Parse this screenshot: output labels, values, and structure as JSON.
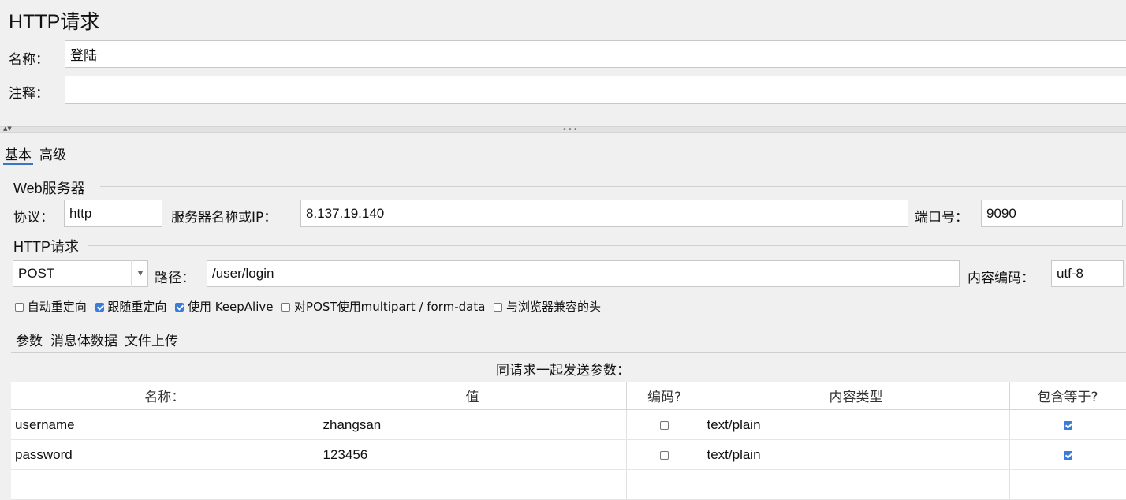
{
  "window": {
    "title": "HTTP请求"
  },
  "name_field": {
    "label": "名称：",
    "value": "登陆"
  },
  "comment_field": {
    "label": "注释：",
    "value": ""
  },
  "top_tabs": [
    {
      "label": "基本",
      "active": true
    },
    {
      "label": "高级",
      "active": false
    }
  ],
  "web_server": {
    "section_label": "Web服务器",
    "protocol_label": "协议：",
    "protocol_value": "http",
    "server_label": "服务器名称或IP：",
    "server_value": "8.137.19.140",
    "port_label": "端口号：",
    "port_value": "9090"
  },
  "http_request": {
    "section_label": "HTTP请求",
    "method": "POST",
    "path_label": "路径：",
    "path_value": "/user/login",
    "encoding_label": "内容编码：",
    "encoding_value": "utf-8"
  },
  "options": [
    {
      "label": "自动重定向",
      "checked": false
    },
    {
      "label": "跟随重定向",
      "checked": true
    },
    {
      "label": "使用 KeepAlive",
      "checked": true
    },
    {
      "label": "对POST使用multipart / form-data",
      "checked": false
    },
    {
      "label": "与浏览器兼容的头",
      "checked": false
    }
  ],
  "body_tabs": [
    {
      "label": "参数",
      "active": true
    },
    {
      "label": "消息体数据",
      "active": false
    },
    {
      "label": "文件上传",
      "active": false
    }
  ],
  "params_table": {
    "caption": "同请求一起发送参数：",
    "headers": [
      "名称：",
      "值",
      "编码?",
      "内容类型",
      "包含等于?"
    ],
    "rows": [
      {
        "name": "username",
        "value": "zhangsan",
        "encode": false,
        "content_type": "text/plain",
        "include_equals": true
      },
      {
        "name": "password",
        "value": "123456",
        "encode": false,
        "content_type": "text/plain",
        "include_equals": true
      }
    ]
  },
  "colors": {
    "accent": "#3a7dd8",
    "background": "#f0f0f0"
  }
}
